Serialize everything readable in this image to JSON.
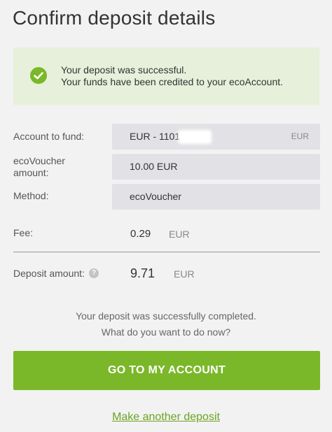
{
  "page": {
    "title": "Confirm deposit details"
  },
  "alert": {
    "line1": "Your deposit was successful.",
    "line2": "Your funds have been credited to your ecoAccount.",
    "icon": "check-circle-icon",
    "color": "#7ab829"
  },
  "form": {
    "account_label": "Account to fund:",
    "account_value": "EUR - 1101",
    "account_currency": "EUR",
    "voucher_label_line1": "ecoVoucher",
    "voucher_label_line2": "amount:",
    "voucher_value": "10.00 EUR",
    "method_label": "Method:",
    "method_value": "ecoVoucher",
    "fee_label": "Fee:",
    "fee_value": "0.29",
    "fee_currency": "EUR",
    "deposit_label": "Deposit amount:",
    "deposit_value": "9.71",
    "deposit_currency": "EUR",
    "help_glyph": "?"
  },
  "completion": {
    "line1": "Your deposit was successfully completed.",
    "line2": "What do you want to do now?"
  },
  "actions": {
    "primary_label": "GO TO MY ACCOUNT",
    "secondary_label": "Make another deposit",
    "accent": "#7ab829"
  }
}
